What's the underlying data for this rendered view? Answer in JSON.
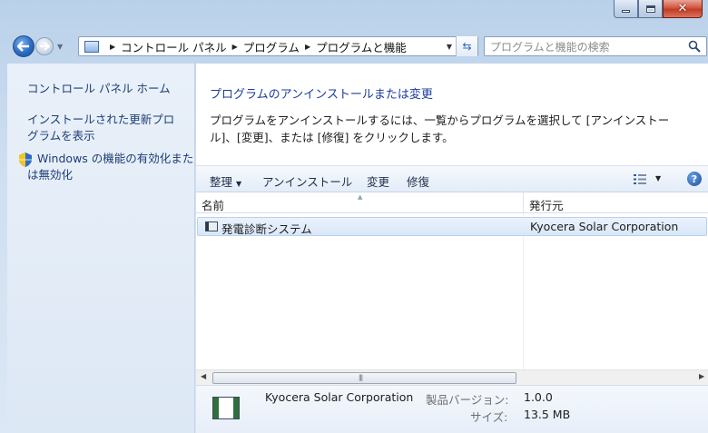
{
  "window": {
    "buttons": {
      "minimize": "minimize",
      "maximize": "maximize",
      "close": "close"
    }
  },
  "address": {
    "crumbs": [
      "コントロール パネル",
      "プログラム",
      "プログラムと機能"
    ]
  },
  "search": {
    "placeholder": "プログラムと機能の検索"
  },
  "sidebar": {
    "home": "コントロール パネル ホーム",
    "updates_line1": "インストールされた更新プロ",
    "updates_line2": "グラムを表示",
    "features_line1": "Windows の機能の有効化また",
    "features_line2": "は無効化"
  },
  "main": {
    "heading": "プログラムのアンインストールまたは変更",
    "desc_line1": "プログラムをアンインストールするには、一覧からプログラムを選択して [アンインストー",
    "desc_line2": "ル]、[変更]、または [修復] をクリックします。"
  },
  "toolbar": {
    "organize": "整理",
    "uninstall": "アンインストール",
    "change": "変更",
    "repair": "修復"
  },
  "table": {
    "columns": {
      "name": "名前",
      "publisher": "発行元"
    },
    "rows": [
      {
        "name": "発電診断システム",
        "publisher": "Kyocera Solar Corporation"
      }
    ]
  },
  "details": {
    "publisher": "Kyocera Solar Corporation",
    "version_label": "製品バージョン:",
    "version": "1.0.0",
    "size_label": "サイズ:",
    "size": "13.5 MB"
  },
  "colors": {
    "link": "#1e3d73",
    "heading": "#1e3d9a",
    "selection": "#d9e7f8",
    "close_button": "#c23b24"
  }
}
